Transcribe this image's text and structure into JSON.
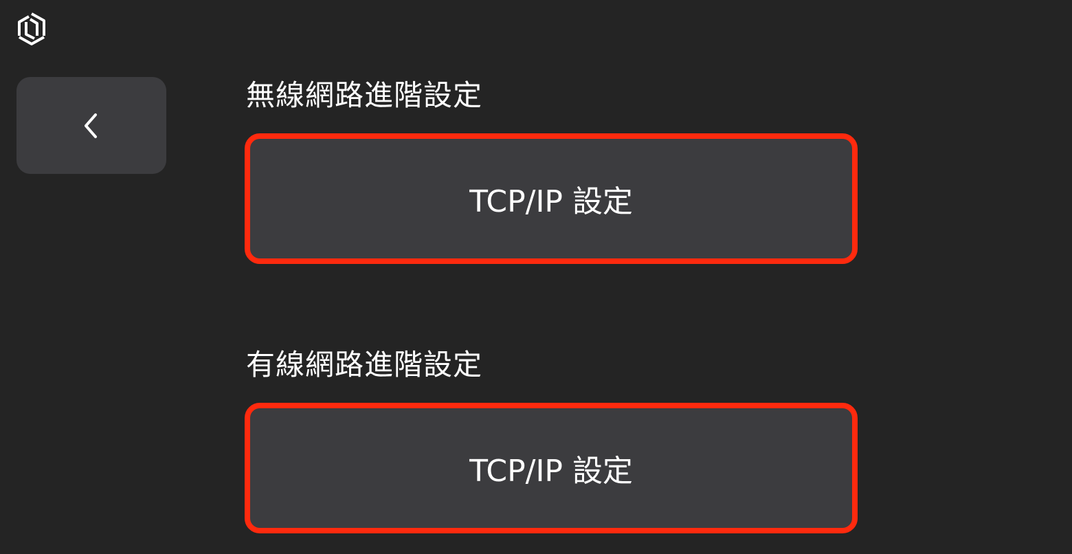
{
  "header": {
    "logo_icon": "hexagon-logo-icon"
  },
  "nav": {
    "back_icon": "chevron-left-icon"
  },
  "sections": [
    {
      "title": "無線網路進階設定",
      "button_label": "TCP/IP 設定"
    },
    {
      "title": "有線網路進階設定",
      "button_label": "TCP/IP 設定"
    }
  ],
  "colors": {
    "background": "#242424",
    "button_background": "#3c3c3f",
    "highlight_border": "#ff2a0e",
    "text": "#ffffff"
  }
}
